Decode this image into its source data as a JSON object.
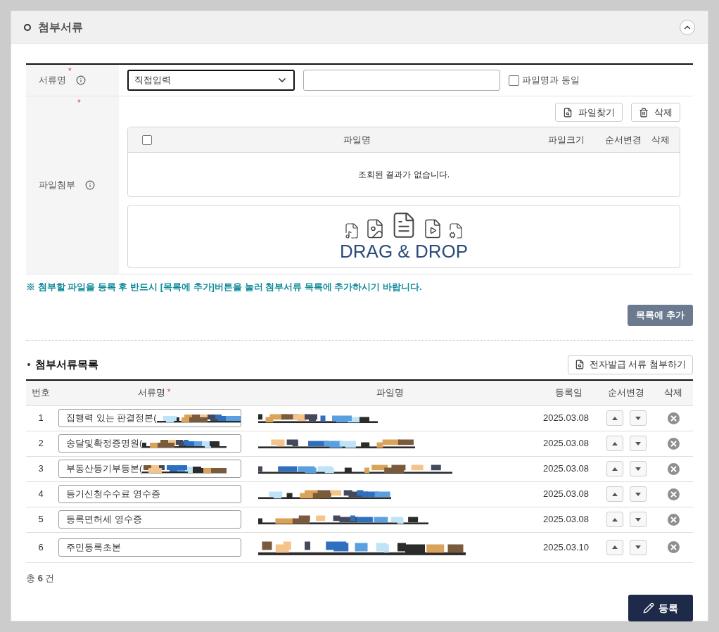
{
  "section": {
    "title": "첨부서류",
    "expanded": true
  },
  "form": {
    "doc_name": {
      "label": "서류명",
      "required_mark": "*",
      "select_value": "직접입력",
      "same_as_filename": {
        "label": "파일명과 동일",
        "checked": false
      }
    },
    "attach": {
      "label": "파일첨부",
      "required_mark": "*",
      "buttons": [
        "파일찾기",
        "삭제"
      ],
      "all_checked": false,
      "columns": [
        "파일명",
        "파일크기",
        "순서변경",
        "삭제"
      ],
      "empty_message": "조회된 결과가 없습니다.",
      "dropzone": "DRAG & DROP"
    }
  },
  "notice": "※ 첨부할 파일을 등록 후 반드시 [목록에 추가]버튼을 눌러 첨부서류 목록에 추가하시기 바랍니다.",
  "add_button": "목록에 추가",
  "list": {
    "title": "첨부서류목록",
    "e_doc_button": "전자발급 서류 첨부하기",
    "columns": [
      {
        "label": "번호"
      },
      {
        "label": "서류명",
        "required_mark": "*"
      },
      {
        "label": "파일명"
      },
      {
        "label": "등록일"
      },
      {
        "label": "순서변경"
      },
      {
        "label": "삭제"
      }
    ],
    "rows": [
      {
        "no": "1",
        "doc_name": "집행력 있는 판결정본(",
        "redacted": true,
        "date": "2025.03.08"
      },
      {
        "no": "2",
        "doc_name": "송달및확정증명원(",
        "redacted": true,
        "date": "2025.03.08"
      },
      {
        "no": "3",
        "doc_name": "부동산등기부등본(",
        "redacted": true,
        "date": "2025.03.08"
      },
      {
        "no": "4",
        "doc_name": "등기신청수수료 영수증",
        "redacted": false,
        "date": "2025.03.08"
      },
      {
        "no": "5",
        "doc_name": "등록면허세 영수증",
        "redacted": false,
        "date": "2025.03.08"
      },
      {
        "no": "6",
        "doc_name": "주민등록초본",
        "redacted": false,
        "date": "2025.03.10"
      }
    ]
  },
  "total": "총 **6** 건",
  "submit": "등록"
}
